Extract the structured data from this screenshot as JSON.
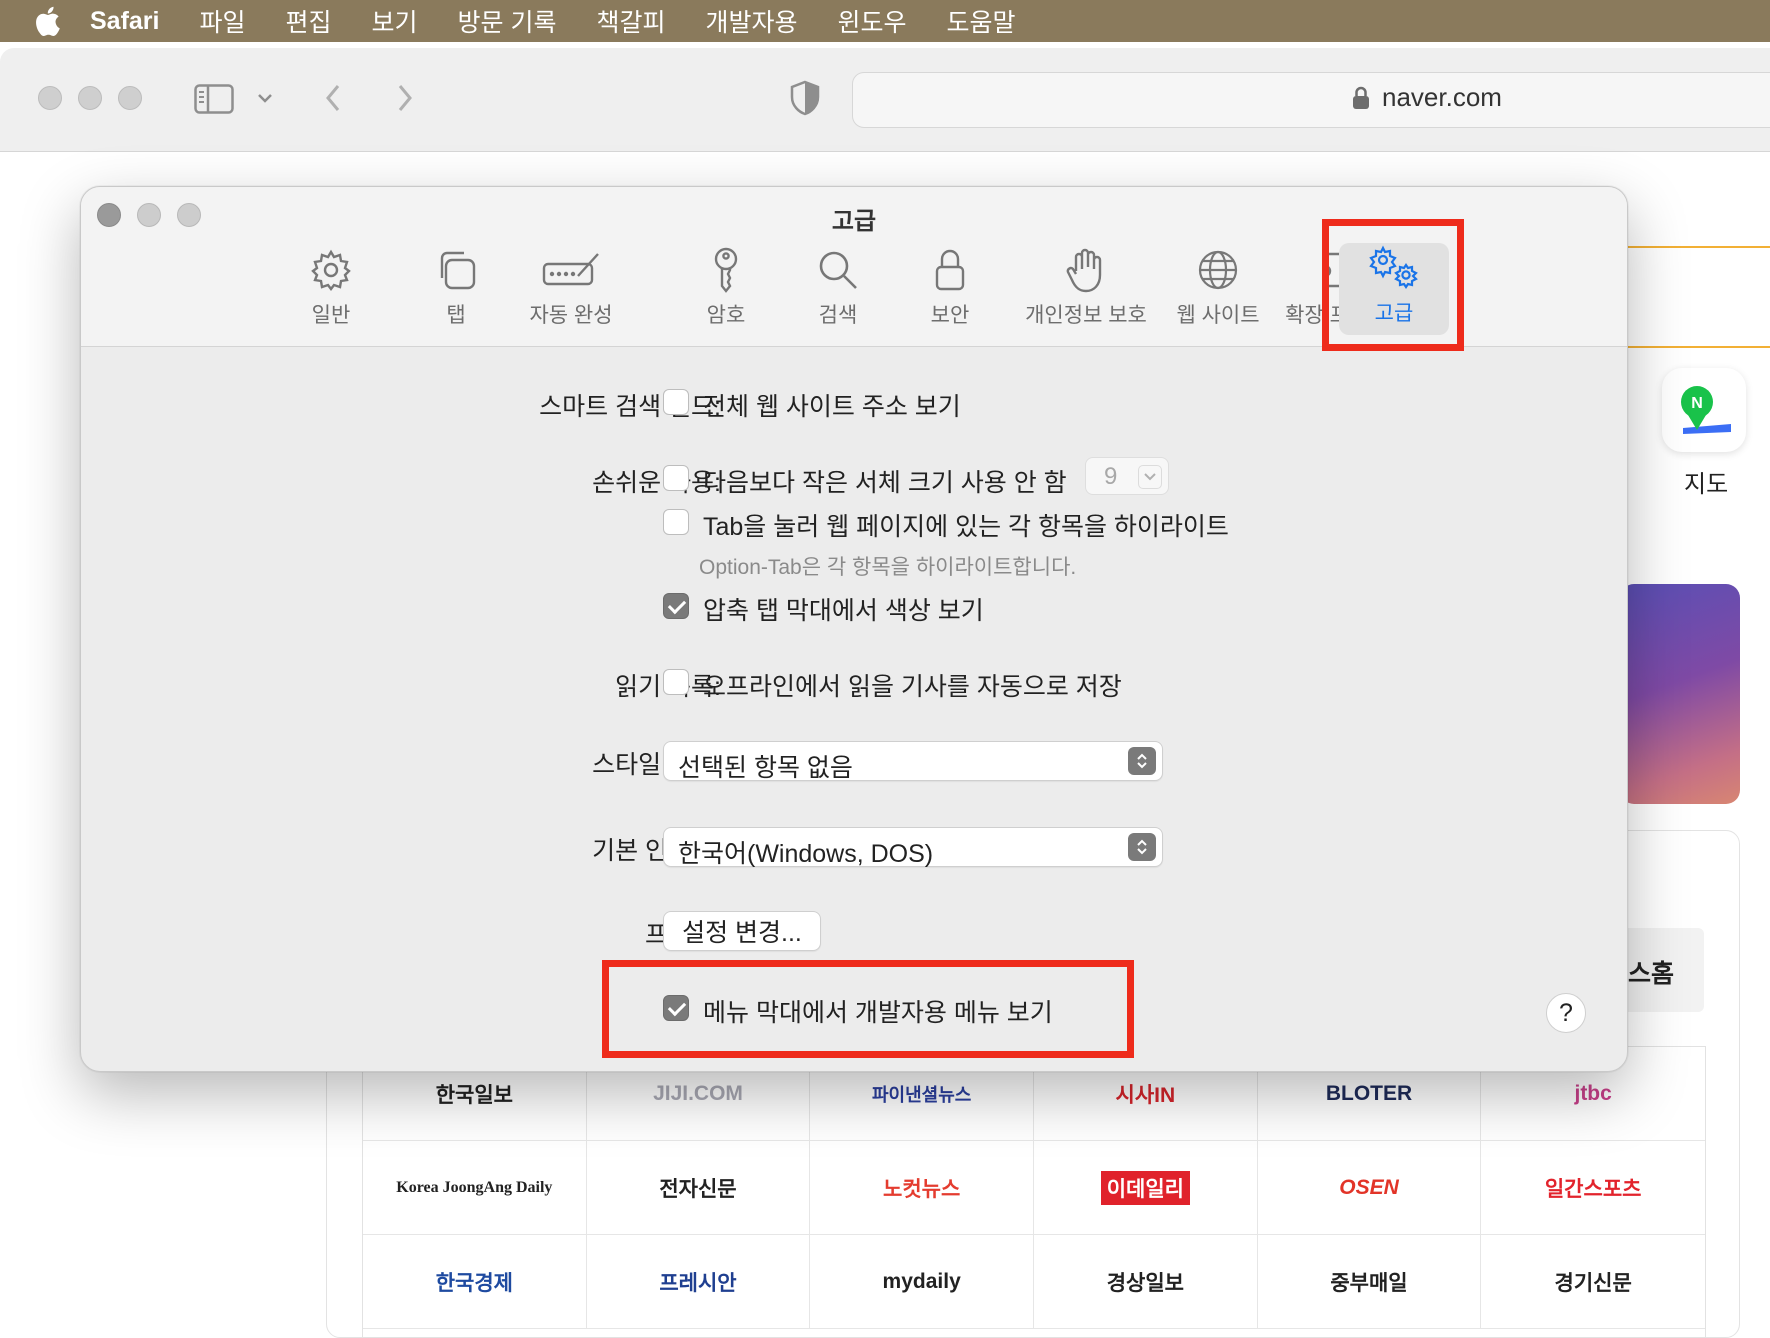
{
  "menubar": {
    "items": [
      "Safari",
      "파일",
      "편집",
      "보기",
      "방문 기록",
      "책갈피",
      "개발자용",
      "윈도우",
      "도움말"
    ]
  },
  "browser": {
    "url": "naver.com"
  },
  "background": {
    "map_label": "지도",
    "partial_label": "스홈",
    "news_outlets": [
      "한국일보",
      "JIJI.COM",
      "파이낸셜뉴스",
      "시사IN",
      "BLOTER",
      "jtbc",
      "Korea JoongAng Daily",
      "전자신문",
      "노컷뉴스",
      "이데일리",
      "OSEN",
      "일간스포츠",
      "한국경제",
      "프레시안",
      "mydaily",
      "경상일보",
      "중부매일",
      "경기신문"
    ]
  },
  "dialog": {
    "title": "고급",
    "tabs": [
      {
        "label": "일반",
        "icon": "gear-icon"
      },
      {
        "label": "탭",
        "icon": "tabs-icon"
      },
      {
        "label": "자동 완성",
        "icon": "autofill-icon"
      },
      {
        "label": "암호",
        "icon": "key-icon"
      },
      {
        "label": "검색",
        "icon": "search-icon"
      },
      {
        "label": "보안",
        "icon": "lock-icon"
      },
      {
        "label": "개인정보 보호",
        "icon": "hand-icon"
      },
      {
        "label": "웹 사이트",
        "icon": "globe-icon"
      },
      {
        "label": "확장 프로그램",
        "icon": "puzzle-icon"
      },
      {
        "label": "고급",
        "icon": "gears-icon"
      }
    ],
    "active_tab": "고급",
    "smart_search": {
      "label": "스마트 검색 필드:",
      "option": "전체 웹 사이트 주소 보기",
      "checked": false
    },
    "accessibility": {
      "label": "손쉬운 사용:",
      "font_option": "다음보다 작은 서체 크기 사용 안 함",
      "font_checked": false,
      "font_size": "9",
      "tab_option": "Tab을 눌러 웹 페이지에 있는 각 항목을 하이라이트",
      "tab_checked": false,
      "tab_hint": "Option-Tab은 각 항목을 하이라이트합니다.",
      "color_option": "압축 탭 막대에서 색상 보기",
      "color_checked": true
    },
    "reading_list": {
      "label": "읽기 목록:",
      "option": "오프라인에서 읽을 기사를 자동으로 저장",
      "checked": false
    },
    "style_sheet": {
      "label": "스타일 시트:",
      "value": "선택된 항목 없음"
    },
    "encoding": {
      "label": "기본 인코딩:",
      "value": "한국어(Windows, DOS)"
    },
    "proxy": {
      "label": "프록시:",
      "button": "설정 변경..."
    },
    "develop_menu": {
      "option": "메뉴 막대에서 개발자용 메뉴 보기",
      "checked": true
    },
    "help": "?"
  },
  "colors": {
    "menubar": "#8a7a5c",
    "accent": "#1a74e8",
    "highlight": "#ee2b1b"
  }
}
